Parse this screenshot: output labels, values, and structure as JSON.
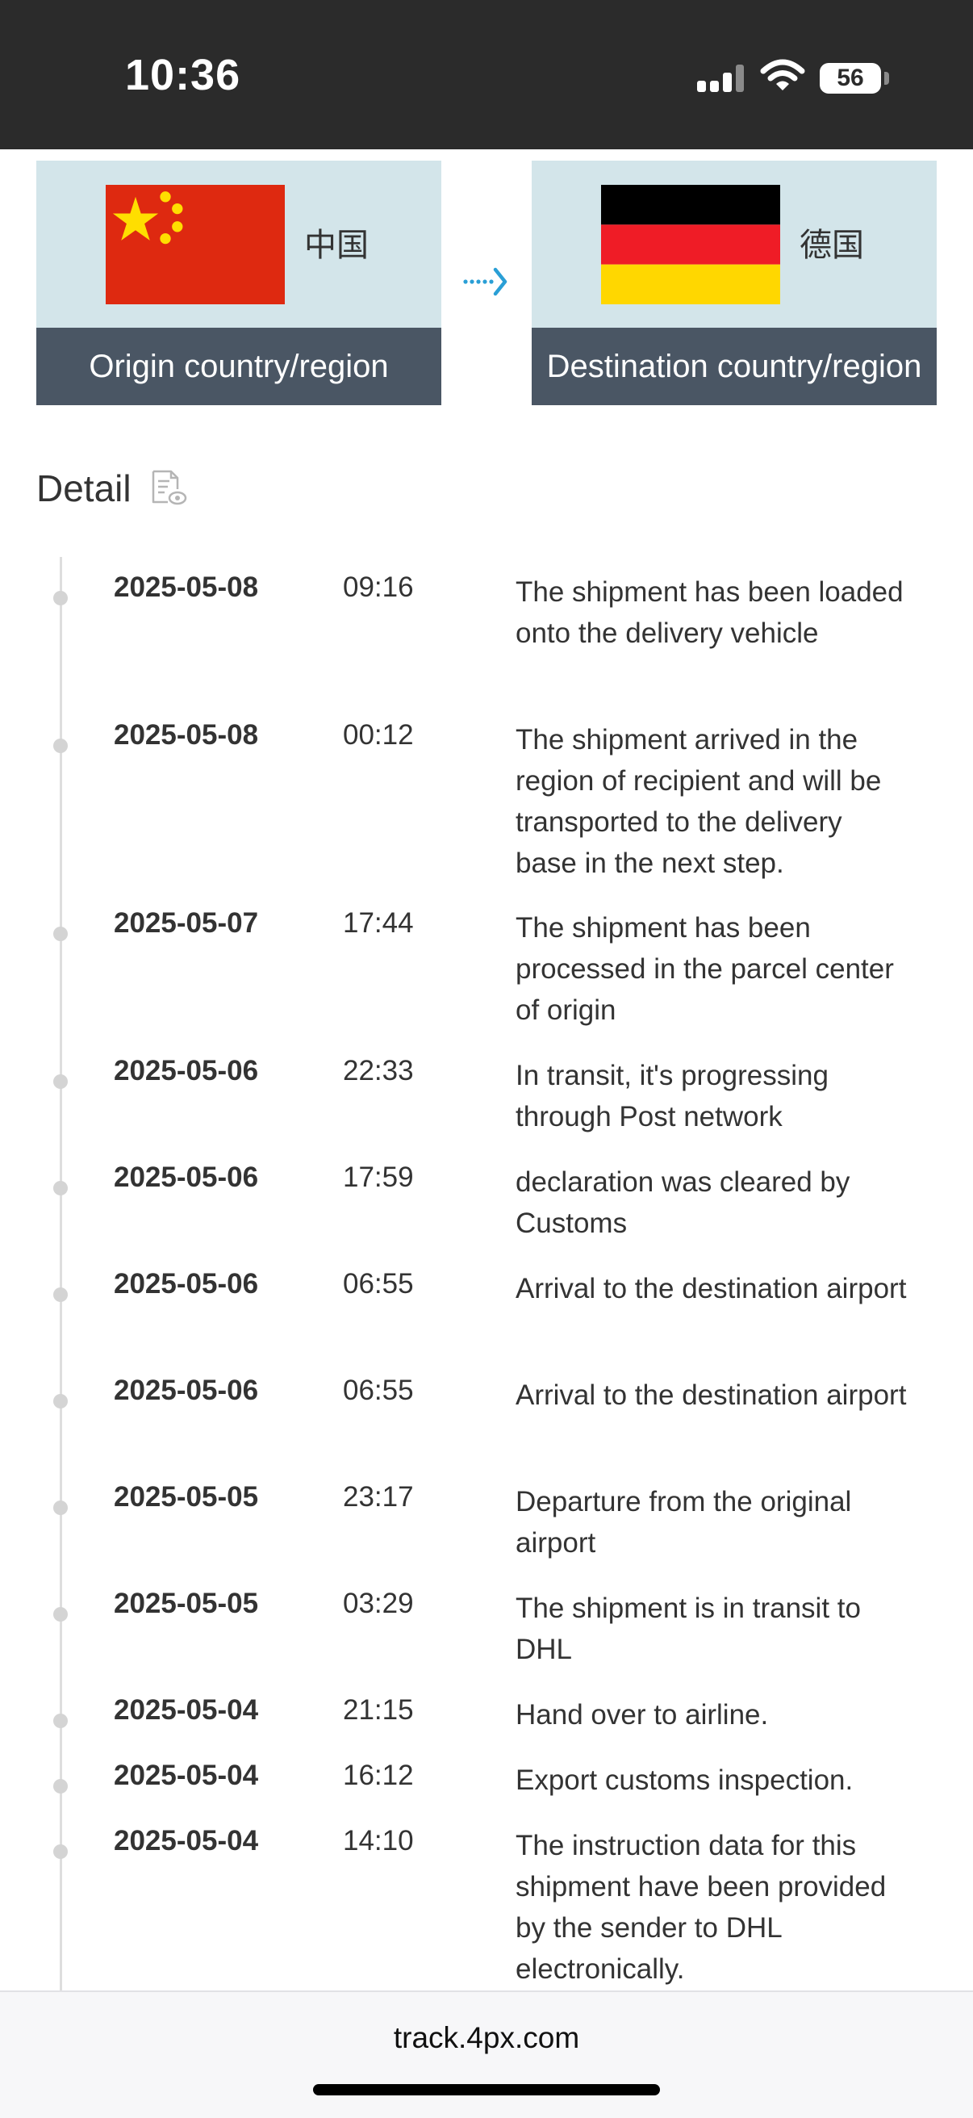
{
  "status_bar": {
    "time": "10:36",
    "battery": "56"
  },
  "route": {
    "origin": {
      "country": "中国",
      "label": "Origin country/region",
      "flag": "china-flag"
    },
    "destination": {
      "country": "德国",
      "label": "Destination country/region",
      "flag": "germany-flag"
    },
    "arrow_icon": "dotted-arrow-right-icon",
    "colors": {
      "card_bg": "#d3e5ea",
      "label_bg": "#4a5664",
      "arrow": "#2a9fd6"
    }
  },
  "detail": {
    "title": "Detail",
    "icon": "document-view-icon"
  },
  "events": [
    {
      "date": "2025-05-08",
      "time": "09:16",
      "description": "The shipment has been loaded onto the delivery vehicle"
    },
    {
      "date": "2025-05-08",
      "time": "00:12",
      "description": "The shipment arrived in the region of recipient and will be transported to the delivery base in the next step."
    },
    {
      "date": "2025-05-07",
      "time": "17:44",
      "description": "The shipment has been processed in the parcel center of origin"
    },
    {
      "date": "2025-05-06",
      "time": "22:33",
      "description": "In transit, it's progressing through Post network"
    },
    {
      "date": "2025-05-06",
      "time": "17:59",
      "description": "declaration was cleared by Customs"
    },
    {
      "date": "2025-05-06",
      "time": "06:55",
      "description": "Arrival to the destination airport"
    },
    {
      "date": "2025-05-06",
      "time": "06:55",
      "description": "Arrival to the destination airport"
    },
    {
      "date": "2025-05-05",
      "time": "23:17",
      "description": "Departure from the original airport"
    },
    {
      "date": "2025-05-05",
      "time": "03:29",
      "description": "The shipment is in transit to DHL"
    },
    {
      "date": "2025-05-04",
      "time": "21:15",
      "description": "Hand over to airline."
    },
    {
      "date": "2025-05-04",
      "time": "16:12",
      "description": "Export customs inspection."
    },
    {
      "date": "2025-05-04",
      "time": "14:10",
      "description": "The instruction data for this shipment have been provided by the sender to DHL electronically."
    }
  ],
  "browser": {
    "url": "track.4px.com"
  }
}
